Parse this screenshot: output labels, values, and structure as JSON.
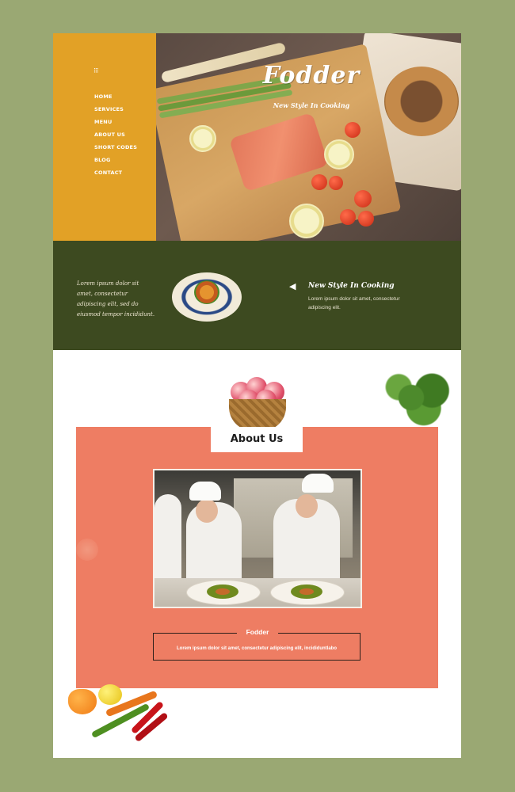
{
  "brand": {
    "name": "Fodder",
    "tagline": "New Style In Cooking"
  },
  "nav": {
    "toggle_icon": "menu-icon",
    "items": [
      "HOME",
      "SERVICES",
      "MENU",
      "ABOUT US",
      "SHORT CODES",
      "BLOG",
      "CONTACT"
    ]
  },
  "band": {
    "left_text": "Lorem ipsum dolor sit amet, consectetur adipiscing elit, sed do eiusmod tempor incididunt.",
    "title": "New Style In Cooking",
    "desc": "Lorem ipsum dolor sit amet, consectetur adipiscing elit.",
    "arrow_icon": "arrow-left-icon"
  },
  "about": {
    "label": "About Us",
    "box_title": "Fodder",
    "box_text": "Lorem ipsum dolor sit amet, consectetur adipiscing elit, incididuntlabo"
  },
  "colors": {
    "background": "#9aa873",
    "sidebar": "#e2a126",
    "band": "#3d4a20",
    "about_bg": "#ee7d63",
    "white": "#ffffff"
  }
}
